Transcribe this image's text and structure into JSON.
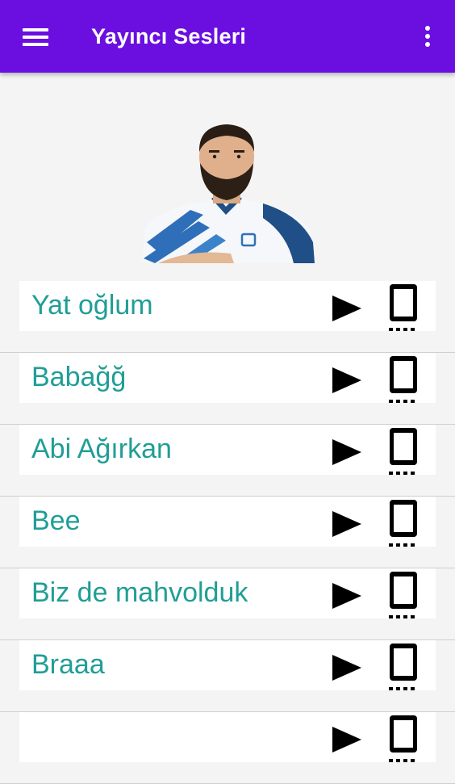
{
  "app_bar": {
    "title": "Yayıncı Sesleri",
    "background": "#6a0fe0",
    "menu_icon": "hamburger-menu-icon",
    "overflow_icon": "more-vert-icon"
  },
  "colors": {
    "accent": "#6a0fe0",
    "label": "#1f9e96",
    "icon": "#000000"
  },
  "sounds": [
    {
      "label": "Yat oğlum"
    },
    {
      "label": "Babağğ"
    },
    {
      "label": "Abi Ağırkan"
    },
    {
      "label": "Bee"
    },
    {
      "label": "Biz de mahvolduk"
    },
    {
      "label": "Braaa"
    },
    {
      "label": ""
    }
  ],
  "row_icons": {
    "play": "play-icon",
    "ringtone": "phone-vibrate-icon"
  }
}
